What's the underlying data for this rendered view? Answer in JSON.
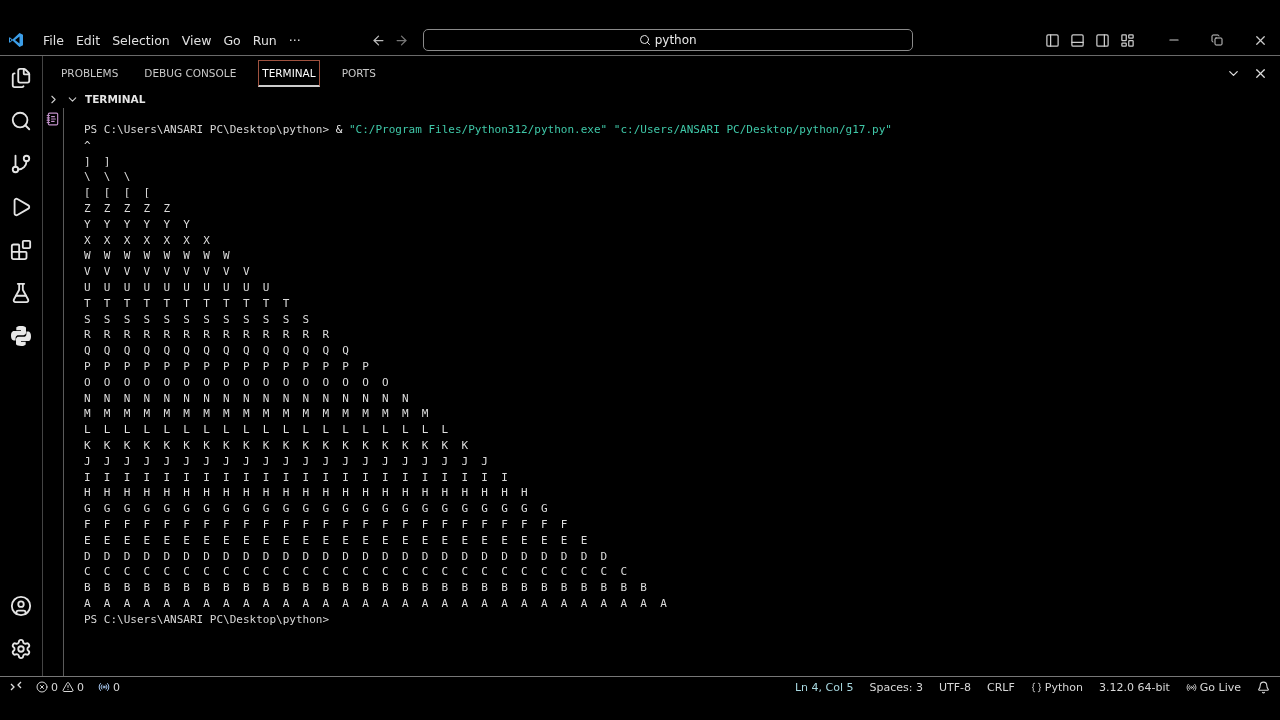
{
  "menu": [
    "File",
    "Edit",
    "Selection",
    "View",
    "Go",
    "Run",
    "···"
  ],
  "search": {
    "value": "python"
  },
  "panel_tabs": [
    {
      "label": "PROBLEMS",
      "selected": false
    },
    {
      "label": "DEBUG CONSOLE",
      "selected": false
    },
    {
      "label": "TERMINAL",
      "selected": true
    },
    {
      "label": "PORTS",
      "selected": false
    }
  ],
  "section": {
    "title": "TERMINAL",
    "expanded": true
  },
  "terminal": {
    "command": {
      "prompt": "PS C:\\Users\\ANSARI PC\\Desktop\\python>",
      "operator": "&",
      "arguments": [
        "\"C:/Program Files/Python312/python.exe\"",
        "\"c:/Users/ANSARI PC/Desktop/python/g17.py\""
      ]
    },
    "output": [
      "^",
      "]  ]",
      "\\  \\  \\",
      "[  [  [  [",
      "Z  Z  Z  Z  Z",
      "Y  Y  Y  Y  Y  Y",
      "X  X  X  X  X  X  X",
      "W  W  W  W  W  W  W  W",
      "V  V  V  V  V  V  V  V  V",
      "U  U  U  U  U  U  U  U  U  U",
      "T  T  T  T  T  T  T  T  T  T  T",
      "S  S  S  S  S  S  S  S  S  S  S  S",
      "R  R  R  R  R  R  R  R  R  R  R  R  R",
      "Q  Q  Q  Q  Q  Q  Q  Q  Q  Q  Q  Q  Q  Q",
      "P  P  P  P  P  P  P  P  P  P  P  P  P  P  P",
      "O  O  O  O  O  O  O  O  O  O  O  O  O  O  O  O",
      "N  N  N  N  N  N  N  N  N  N  N  N  N  N  N  N  N",
      "M  M  M  M  M  M  M  M  M  M  M  M  M  M  M  M  M  M",
      "L  L  L  L  L  L  L  L  L  L  L  L  L  L  L  L  L  L  L",
      "K  K  K  K  K  K  K  K  K  K  K  K  K  K  K  K  K  K  K  K",
      "J  J  J  J  J  J  J  J  J  J  J  J  J  J  J  J  J  J  J  J  J",
      "I  I  I  I  I  I  I  I  I  I  I  I  I  I  I  I  I  I  I  I  I  I",
      "H  H  H  H  H  H  H  H  H  H  H  H  H  H  H  H  H  H  H  H  H  H  H",
      "G  G  G  G  G  G  G  G  G  G  G  G  G  G  G  G  G  G  G  G  G  G  G  G",
      "F  F  F  F  F  F  F  F  F  F  F  F  F  F  F  F  F  F  F  F  F  F  F  F  F",
      "E  E  E  E  E  E  E  E  E  E  E  E  E  E  E  E  E  E  E  E  E  E  E  E  E  E",
      "D  D  D  D  D  D  D  D  D  D  D  D  D  D  D  D  D  D  D  D  D  D  D  D  D  D  D",
      "C  C  C  C  C  C  C  C  C  C  C  C  C  C  C  C  C  C  C  C  C  C  C  C  C  C  C  C",
      "B  B  B  B  B  B  B  B  B  B  B  B  B  B  B  B  B  B  B  B  B  B  B  B  B  B  B  B  B",
      "A  A  A  A  A  A  A  A  A  A  A  A  A  A  A  A  A  A  A  A  A  A  A  A  A  A  A  A  A  A"
    ],
    "final_prompt": "PS C:\\Users\\ANSARI PC\\Desktop\\python>"
  },
  "status_bar": {
    "errors": "0",
    "warnings": "0",
    "ports": "0",
    "items": [
      {
        "kind": "text",
        "label": "Ln 4, Col 5"
      },
      {
        "kind": "text",
        "label": "Spaces: 3"
      },
      {
        "kind": "text",
        "label": "UTF-8"
      },
      {
        "kind": "text",
        "label": "CRLF"
      },
      {
        "kind": "language",
        "label": "Python"
      },
      {
        "kind": "text",
        "label": "3.12.0 64-bit"
      },
      {
        "kind": "live",
        "label": "Go Live"
      }
    ]
  }
}
